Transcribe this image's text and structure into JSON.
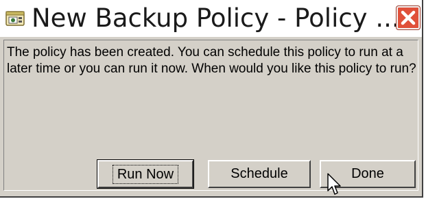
{
  "window": {
    "title": "New Backup Policy - Policy ...",
    "icon": "policy-window-icon",
    "close_icon": "close-icon"
  },
  "message": {
    "text": "The policy has been created. You can schedule this policy to run at a later time or you can run it now. When would you like this policy to run?"
  },
  "buttons": {
    "run_now": "Run Now",
    "schedule": "Schedule",
    "done": "Done"
  },
  "colors": {
    "dialog_bg": "#d4d0c8",
    "close_button": "#e0503a",
    "titlebar_bg": "#ffffff"
  }
}
